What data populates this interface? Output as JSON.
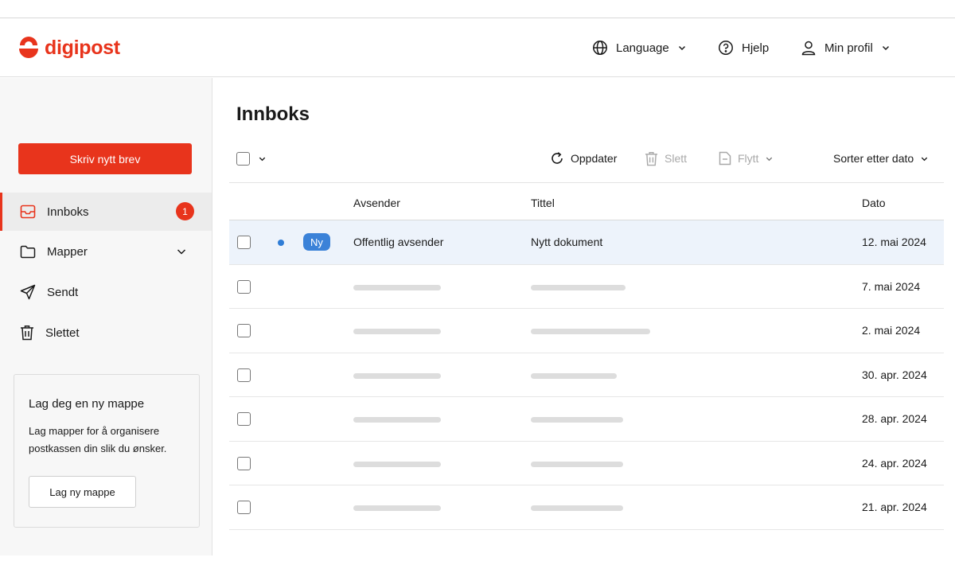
{
  "brand": {
    "name": "digipost",
    "accent": "#e8341c",
    "link_blue": "#3b82d8"
  },
  "header": {
    "language": {
      "label": "Language",
      "icon": "globe-icon"
    },
    "help": {
      "label": "Hjelp",
      "icon": "question-circle-icon"
    },
    "profile": {
      "label": "Min profil",
      "icon": "user-icon"
    }
  },
  "sidebar": {
    "compose_label": "Skriv nytt brev",
    "items": [
      {
        "label": "Innboks",
        "icon": "inbox-icon",
        "badge": "1",
        "active": true
      },
      {
        "label": "Mapper",
        "icon": "folder-icon",
        "expandable": true
      },
      {
        "label": "Sendt",
        "icon": "send-icon"
      },
      {
        "label": "Slettet",
        "icon": "trash-icon"
      }
    ],
    "promo": {
      "title": "Lag deg en ny mappe",
      "text": "Lag mapper for å organisere postkassen din slik du ønsker.",
      "button": "Lag ny mappe"
    }
  },
  "main": {
    "title": "Innboks",
    "toolbar": {
      "refresh": "Oppdater",
      "delete": "Slett",
      "move": "Flytt",
      "sort": "Sorter etter dato"
    },
    "columns": {
      "sender": "Avsender",
      "title": "Tittel",
      "date": "Dato"
    },
    "rows": [
      {
        "unread": true,
        "tag": "Ny",
        "sender": "Offentlig avsender",
        "title": "Nytt dokument",
        "date": "12. mai 2024"
      },
      {
        "date": "7. mai 2024"
      },
      {
        "date": "2. mai 2024"
      },
      {
        "date": "30. apr. 2024"
      },
      {
        "date": "28. apr. 2024"
      },
      {
        "date": "24. apr. 2024"
      },
      {
        "date": "21. apr. 2024"
      }
    ]
  }
}
